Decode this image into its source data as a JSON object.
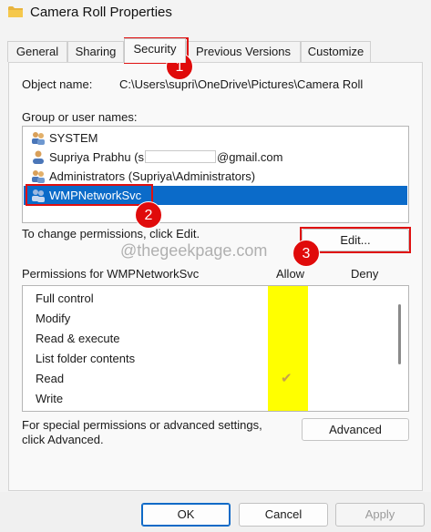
{
  "window": {
    "title": "Camera Roll Properties",
    "icon": "folder-icon"
  },
  "tabs": [
    {
      "label": "General"
    },
    {
      "label": "Sharing"
    },
    {
      "label": "Security"
    },
    {
      "label": "Previous Versions"
    },
    {
      "label": "Customize"
    }
  ],
  "active_tab": "Security",
  "object": {
    "label": "Object name:",
    "value": "C:\\Users\\supri\\OneDrive\\Pictures\\Camera Roll"
  },
  "groups": {
    "label": "Group or user names:",
    "users": [
      {
        "name": "SYSTEM",
        "icon": "users-icon"
      },
      {
        "name": "Supriya Prabhu (s",
        "suffix": "@gmail.com",
        "icon": "user-icon"
      },
      {
        "name": "Administrators (Supriya\\Administrators)",
        "icon": "users-icon"
      },
      {
        "name": "WMPNetworkSvc",
        "icon": "users-icon",
        "selected": true
      }
    ]
  },
  "change_text": "To change permissions, click Edit.",
  "edit_label": "Edit...",
  "watermark": "@thegeekpage.com",
  "permissions": {
    "label": "Permissions for WMPNetworkSvc",
    "allow_header": "Allow",
    "deny_header": "Deny",
    "rows": [
      {
        "name": "Full control",
        "allow": false
      },
      {
        "name": "Modify",
        "allow": false
      },
      {
        "name": "Read & execute",
        "allow": false
      },
      {
        "name": "List folder contents",
        "allow": false
      },
      {
        "name": "Read",
        "allow": true
      },
      {
        "name": "Write",
        "allow": false
      }
    ],
    "check_glyph": "✔"
  },
  "special": {
    "line1": "For special permissions or advanced settings,",
    "line2": "click Advanced.",
    "button": "Advanced"
  },
  "footer": {
    "ok": "OK",
    "cancel": "Cancel",
    "apply": "Apply"
  },
  "annotations": [
    {
      "number": "1"
    },
    {
      "number": "2"
    },
    {
      "number": "3"
    }
  ],
  "colors": {
    "selection": "#0b6bc9",
    "highlight": "#ffff00",
    "annotation": "#e00b0b"
  }
}
